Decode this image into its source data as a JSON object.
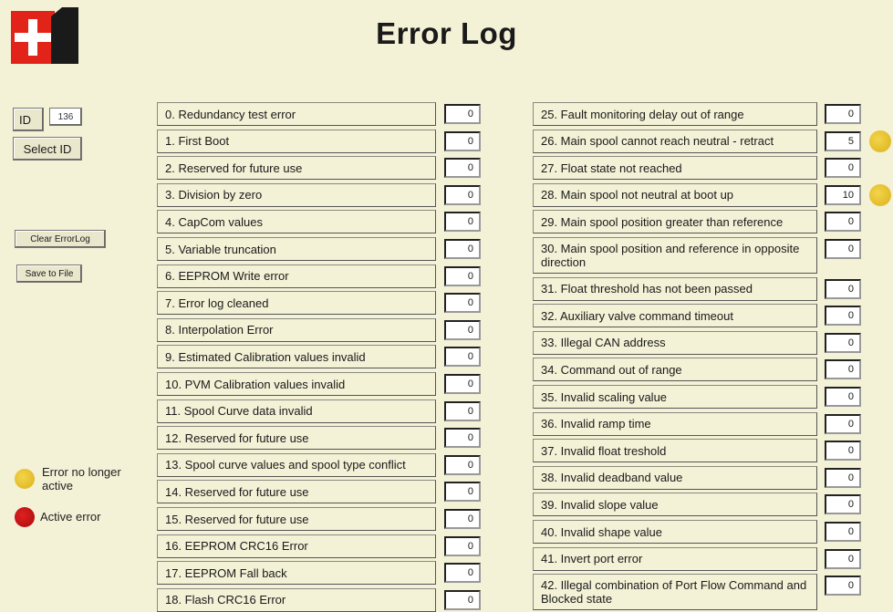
{
  "page": {
    "title": "Error Log"
  },
  "sidebar": {
    "id_label": "ID",
    "id_value": "136",
    "select_id_label": "Select ID",
    "clear_label": "Clear ErrorLog",
    "save_label": "Save to File"
  },
  "legend": {
    "inactive_label": "Error no longer active",
    "active_label": "Active error",
    "inactive_color": "#e4bf2a",
    "active_color": "#c81414"
  },
  "errors_left": [
    {
      "label": "0. Redundancy test error",
      "value": "0"
    },
    {
      "label": "1. First Boot",
      "value": "0"
    },
    {
      "label": "2. Reserved for future use",
      "value": "0"
    },
    {
      "label": "3. Division by zero",
      "value": "0"
    },
    {
      "label": "4. CapCom values",
      "value": "0"
    },
    {
      "label": "5. Variable truncation",
      "value": "0"
    },
    {
      "label": "6. EEPROM Write error",
      "value": "0"
    },
    {
      "label": "7. Error log cleaned",
      "value": "0"
    },
    {
      "label": "8. Interpolation Error",
      "value": "0"
    },
    {
      "label": "9. Estimated Calibration values invalid",
      "value": "0"
    },
    {
      "label": "10. PVM Calibration values invalid",
      "value": "0"
    },
    {
      "label": "11. Spool Curve data invalid",
      "value": "0"
    },
    {
      "label": "12. Reserved for future use",
      "value": "0"
    },
    {
      "label": "13. Spool curve values and spool type conflict",
      "value": "0"
    },
    {
      "label": "14. Reserved for future use",
      "value": "0"
    },
    {
      "label": "15. Reserved for future use",
      "value": "0"
    },
    {
      "label": "16. EEPROM CRC16 Error",
      "value": "0"
    },
    {
      "label": "17. EEPROM Fall back",
      "value": "0"
    },
    {
      "label": "18. Flash CRC16 Error",
      "value": "0"
    }
  ],
  "errors_right": [
    {
      "label": "25. Fault monitoring delay out of range",
      "value": "0"
    },
    {
      "label": "26. Main spool cannot reach neutral - retract",
      "value": "5",
      "flag": "inactive"
    },
    {
      "label": "27. Float state not reached",
      "value": "0"
    },
    {
      "label": "28. Main spool not neutral at boot up",
      "value": "10",
      "flag": "inactive"
    },
    {
      "label": "29. Main spool position greater than reference",
      "value": "0"
    },
    {
      "label": "30. Main spool position and reference in opposite direction",
      "value": "0"
    },
    {
      "label": "31. Float threshold has not been passed",
      "value": "0"
    },
    {
      "label": "32. Auxiliary valve command timeout",
      "value": "0"
    },
    {
      "label": "33. Illegal CAN address",
      "value": "0"
    },
    {
      "label": "34. Command out of range",
      "value": "0"
    },
    {
      "label": "35. Invalid scaling value",
      "value": "0"
    },
    {
      "label": "36. Invalid ramp time",
      "value": "0"
    },
    {
      "label": "37. Invalid float treshold",
      "value": "0"
    },
    {
      "label": "38. Invalid deadband value",
      "value": "0"
    },
    {
      "label": "39. Invalid slope value",
      "value": "0"
    },
    {
      "label": "40. Invalid shape value",
      "value": "0"
    },
    {
      "label": "41. Invert port error",
      "value": "0"
    },
    {
      "label": "42. Illegal combination of Port Flow Command and Blocked state",
      "value": "0"
    }
  ]
}
